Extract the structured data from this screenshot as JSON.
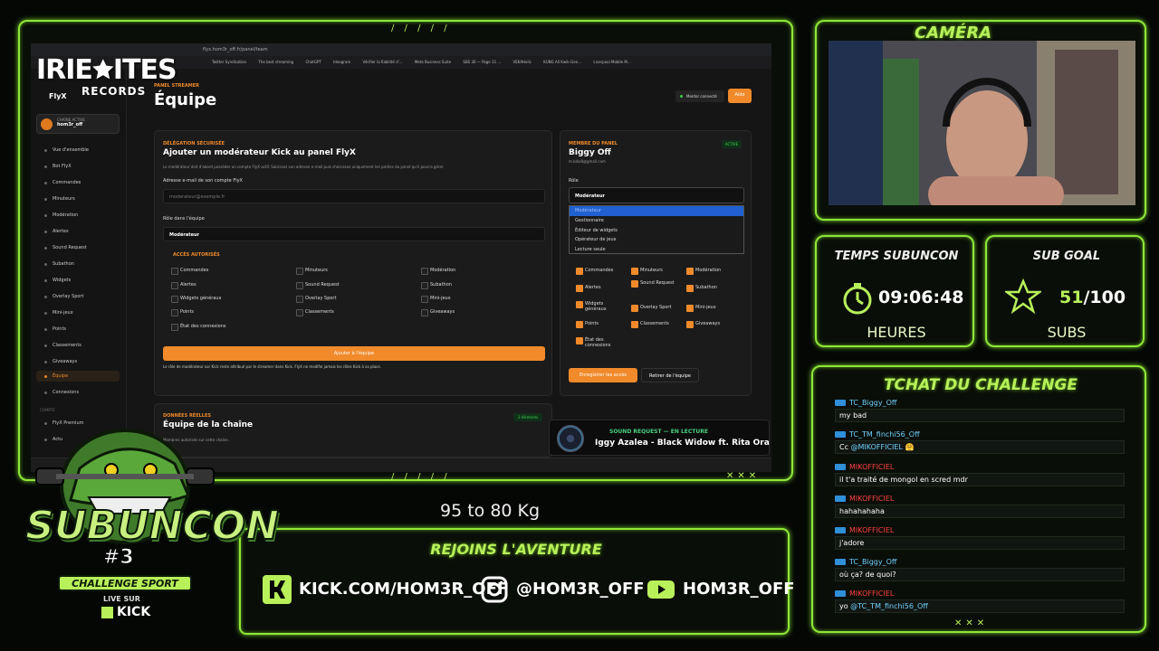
{
  "browser": {
    "url": "flyx.hom3r_off.fr/panel/team",
    "bookmarks": [
      "Twitter Syndication",
      "The best streaming",
      "ChatGPT",
      "Ideogram",
      "Vérifier la fiabilité d'...",
      "Meta Business Suite",
      "SBS 30 — Page 11 ...",
      "VEKAHolic",
      "KUNG All Kwik-Gen...",
      "Liverpool Mobile M..."
    ]
  },
  "sidebar": {
    "brand": "FlyX",
    "channel_label": "CHAÎNE ACTIVE",
    "channel_name": "hom3r_off",
    "items": [
      {
        "label": "Vue d'ensemble"
      },
      {
        "label": "Bot FlyX"
      },
      {
        "label": "Commandes"
      },
      {
        "label": "Minuteurs"
      },
      {
        "label": "Modération"
      },
      {
        "label": "Alertes"
      },
      {
        "label": "Sound Request"
      },
      {
        "label": "Subathon"
      },
      {
        "label": "Widgets"
      },
      {
        "label": "Overlay Sport"
      },
      {
        "label": "Mini-jeux"
      },
      {
        "label": "Points"
      },
      {
        "label": "Classements"
      },
      {
        "label": "Giveaways"
      },
      {
        "label": "Équipe"
      },
      {
        "label": "Connexions"
      },
      {
        "label": "FlyX Premium"
      },
      {
        "label": "Actu"
      }
    ],
    "section_compte": "COMPTE"
  },
  "page": {
    "kicker": "PANEL STREAMER",
    "title": "Équipe",
    "mentor_label": "Mentor connecté",
    "help_label": "Aide"
  },
  "add_card": {
    "kicker": "DÉLÉGATION SÉCURISÉE",
    "title": "Ajouter un modérateur Kick au panel FlyX",
    "description": "Le modérateur doit d'abord posséder un compte FlyX actif. Saisissez son adresse e-mail puis choisissez uniquement les parties du panel qu'il pourra gérer.",
    "email_label": "Adresse e-mail de son compte FlyX",
    "email_placeholder": "moderateur@exemple.fr",
    "role_label": "Rôle dans l'équipe",
    "role_value": "Modérateur",
    "access_label": "ACCÈS AUTORISÉS",
    "permissions": [
      "Commandes",
      "Minuteurs",
      "Modération",
      "Alertes",
      "Sound Request",
      "Subathon",
      "Widgets généraux",
      "Overlay Sport",
      "Mini-jeux",
      "Points",
      "Classements",
      "Giveaways",
      "État des connexions"
    ],
    "add_button": "Ajouter à l'équipe",
    "footnote": "Le rôle de modérateur sur Kick reste attribué par le streamer dans Kick. FlyX ne modifie jamais les rôles Kick à sa place."
  },
  "member_card": {
    "kicker": "MEMBRE DU PANEL",
    "name": "Biggy Off",
    "email": "m.biko8@gmail.com",
    "badge": "ACTIVE",
    "role_label": "Rôle",
    "role_value": "Modérateur",
    "role_options": [
      "Modérateur",
      "Gestionnaire",
      "Éditeur de widgets",
      "Opérateur de jeux",
      "Lecture seule"
    ],
    "permissions": [
      "Commandes",
      "Minuteurs",
      "Modération",
      "Alertes",
      "Sound Request",
      "Subathon",
      "Widgets généraux",
      "Overlay Sport",
      "Mini-jeux",
      "Points",
      "Classements",
      "Giveaways",
      "État des connexions"
    ],
    "save_button": "Enregistrer les accès",
    "remove_button": "Retirer de l'équipe"
  },
  "bottom_card": {
    "kicker": "DONNÉES RÉELLES",
    "title": "Équipe de la chaîne",
    "sub": "Membres autorisés sur cette chaîne.",
    "badge": "2 éléments"
  },
  "now_playing": {
    "kicker": "SOUND REQUEST — EN LECTURE",
    "track": "Iggy Azalea - Black Widow ft. Rita Ora"
  },
  "overlay": {
    "irie_logo": "IRIE🟊ITES",
    "irie_sub": "RECORDS",
    "camera_title": "CAMÉRA",
    "timer_title": "TEMPS SUBUNCON",
    "timer_value": "09:06:48",
    "timer_sub": "HEURES",
    "goal_title": "SUB GOAL",
    "goal_current": "51",
    "goal_target": "/100",
    "goal_sub": "SUBS",
    "chat_title": "TCHAT DU CHALLENGE",
    "weight_text": "95 to 80 Kg",
    "join_title": "REJOINS L'AVENTURE",
    "kick_handle": "KICK.COM/HOM3R_OFF",
    "insta_handle": "@HOM3R_OFF",
    "yt_handle": "HOM3R_OFF",
    "croc_title": "SUBUNCON",
    "croc_number": "#3",
    "croc_sub": "CHALLENGE SPORT",
    "croc_live": "LIVE SUR",
    "croc_kick": "KICK"
  },
  "chat": [
    {
      "user": "TC_Biggy_Off",
      "color": "blue",
      "text": "my bad",
      "mention": ""
    },
    {
      "user": "TC_TM_finchi56_Off",
      "color": "blue",
      "text": "Cc ",
      "mention": "@MIKOFFICIEL 🤗"
    },
    {
      "user": "MIKOFFICIEL",
      "color": "red",
      "text": "il t'a traité de mongol en scred mdr",
      "mention": ""
    },
    {
      "user": "MIKOFFICIEL",
      "color": "red",
      "text": "hahahahaha",
      "mention": ""
    },
    {
      "user": "MIKOFFICIEL",
      "color": "red",
      "text": "j'adore",
      "mention": ""
    },
    {
      "user": "TC_Biggy_Off",
      "color": "blue",
      "text": "où ça? de quoi?",
      "mention": ""
    },
    {
      "user": "MIKOFFICIEL",
      "color": "red",
      "text": "yo ",
      "mention": "@TC_TM_finchi56_Off"
    }
  ],
  "colors": {
    "neon": "#8fe63a",
    "accent": "#f08a2a",
    "bg": "#050705"
  }
}
